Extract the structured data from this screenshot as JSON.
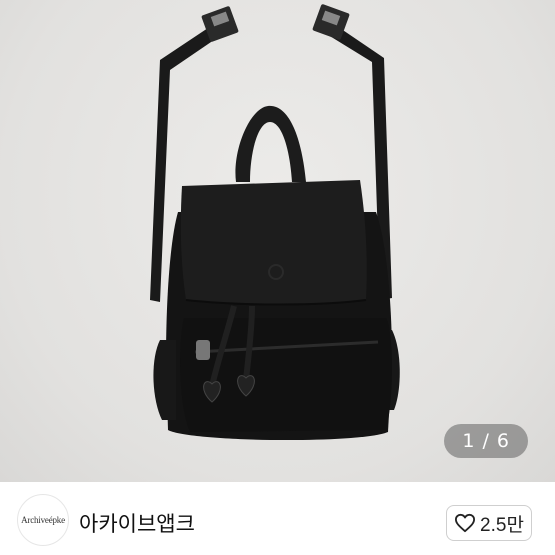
{
  "image_viewer": {
    "current": 1,
    "total": 6,
    "counter_text": "1 / 6",
    "background_color": "#e4e3e1",
    "product_color": "#151515"
  },
  "shop": {
    "avatar_logo_text": "Archiveépke",
    "name": "아카이브앱크"
  },
  "like_button": {
    "icon": "heart-outline-icon",
    "count_text": "2.5만"
  }
}
